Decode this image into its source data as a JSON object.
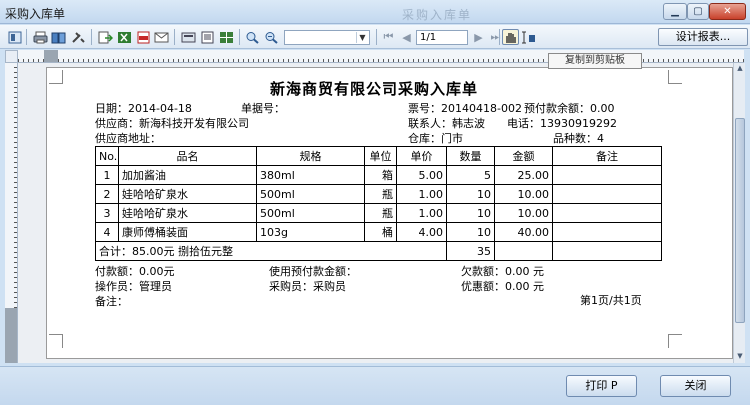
{
  "window": {
    "title": "采购入库单",
    "ghost_title": "采购入库单"
  },
  "toolbar": {
    "page_field": "1/1",
    "zoom_value": "",
    "design_button": "设计报表...",
    "tooltip": "复制到剪贴板"
  },
  "doc": {
    "title": "新海商贸有限公司采购入库单",
    "date": "日期：2014-04-18",
    "voucher_no": "单据号：",
    "ticket_no": "票号：20140418-002",
    "prepay_balance": "预付款余额：0.00",
    "supplier": "供应商：新海科技开发有限公司",
    "contact": "联系人：韩志波",
    "phone": "电话：13930919292",
    "supplier_address": "供应商地址：",
    "warehouse": "仓库：门市",
    "item_kinds": "品种数：4",
    "table": {
      "headers": [
        "No.",
        "品名",
        "规格",
        "单位",
        "单价",
        "数量",
        "金额",
        "备注"
      ],
      "rows": [
        [
          "1",
          "加加酱油",
          "380ml",
          "箱",
          "5.00",
          "5",
          "25.00",
          ""
        ],
        [
          "2",
          "娃哈哈矿泉水",
          "500ml",
          "瓶",
          "1.00",
          "10",
          "10.00",
          ""
        ],
        [
          "3",
          "娃哈哈矿泉水",
          "500ml",
          "瓶",
          "1.00",
          "10",
          "10.00",
          ""
        ],
        [
          "4",
          "康师傅桶装面",
          "103g",
          "桶",
          "4.00",
          "10",
          "40.00",
          ""
        ]
      ],
      "total_label": "合计：85.00元 捌拾伍元整",
      "total_qty": "35"
    },
    "paid": "付款额：0.00元",
    "used_prepay": "使用预付款金额：",
    "owed": "欠款额：0.00 元",
    "operator": "操作员：管理员",
    "buyer": "采购员：采购员",
    "discount": "优惠额：0.00 元",
    "remark": "备注：",
    "page_info": "第1页/共1页"
  },
  "footer": {
    "print_label": "打印 P",
    "close_label": "关闭"
  }
}
